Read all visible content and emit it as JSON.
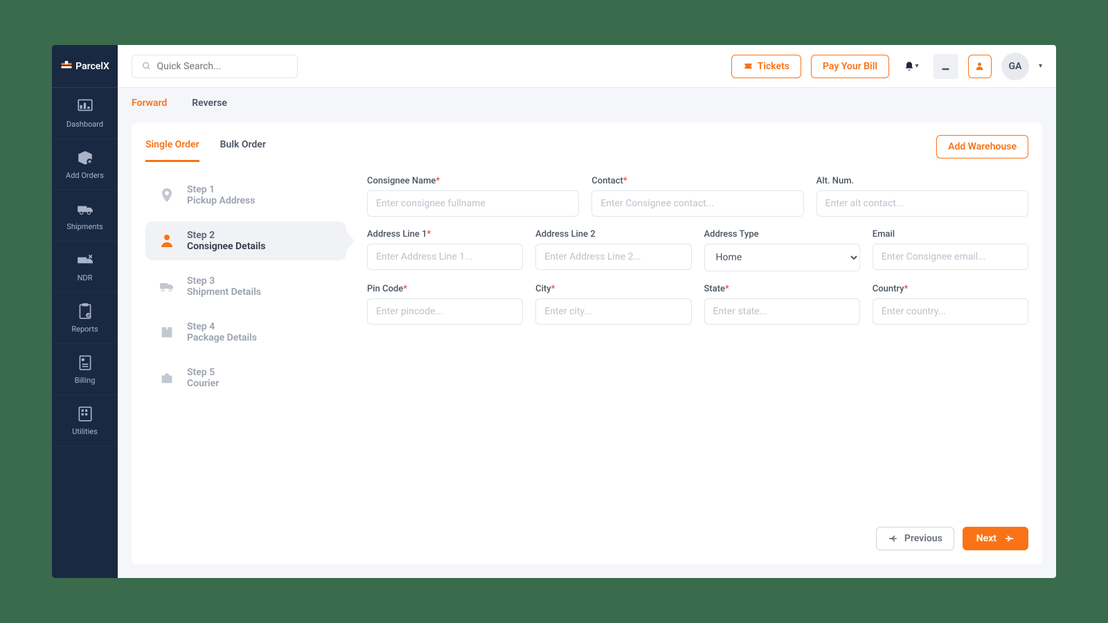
{
  "brand": "ParcelX",
  "search_placeholder": "Quick Search...",
  "topbar": {
    "tickets": "Tickets",
    "pay_bill": "Pay Your Bill",
    "avatar_initials": "GA"
  },
  "sidebar": {
    "items": [
      {
        "label": "Dashboard"
      },
      {
        "label": "Add Orders"
      },
      {
        "label": "Shipments"
      },
      {
        "label": "NDR"
      },
      {
        "label": "Reports"
      },
      {
        "label": "Billing"
      },
      {
        "label": "Utilities"
      }
    ]
  },
  "subtabs": {
    "forward": "Forward",
    "reverse": "Reverse"
  },
  "order_tabs": {
    "single": "Single Order",
    "bulk": "Bulk Order"
  },
  "add_warehouse": "Add Warehouse",
  "steps": [
    {
      "num": "Step 1",
      "label": "Pickup Address"
    },
    {
      "num": "Step 2",
      "label": "Consignee Details"
    },
    {
      "num": "Step 3",
      "label": "Shipment Details"
    },
    {
      "num": "Step 4",
      "label": "Package Details"
    },
    {
      "num": "Step 5",
      "label": "Courier"
    }
  ],
  "form": {
    "consignee_name": {
      "label": "Consignee Name",
      "ph": "Enter consignee fullname",
      "req": true
    },
    "contact": {
      "label": "Contact",
      "ph": "Enter Consignee contact...",
      "req": true
    },
    "alt_num": {
      "label": "Alt. Num.",
      "ph": "Enter alt contact...",
      "req": false
    },
    "addr1": {
      "label": "Address Line 1",
      "ph": "Enter Address Line 1...",
      "req": true
    },
    "addr2": {
      "label": "Address Line 2",
      "ph": "Enter Address Line 2...",
      "req": false
    },
    "addr_type": {
      "label": "Address Type",
      "value": "Home",
      "req": false
    },
    "email": {
      "label": "Email",
      "ph": "Enter Consignee email...",
      "req": false
    },
    "pin": {
      "label": "Pin Code",
      "ph": "Enter pincode...",
      "req": true
    },
    "city": {
      "label": "City",
      "ph": "Enter city...",
      "req": true
    },
    "state": {
      "label": "State",
      "ph": "Enter state...",
      "req": true
    },
    "country": {
      "label": "Country",
      "ph": "Enter country...",
      "req": true
    }
  },
  "buttons": {
    "prev": "Previous",
    "next": "Next"
  }
}
